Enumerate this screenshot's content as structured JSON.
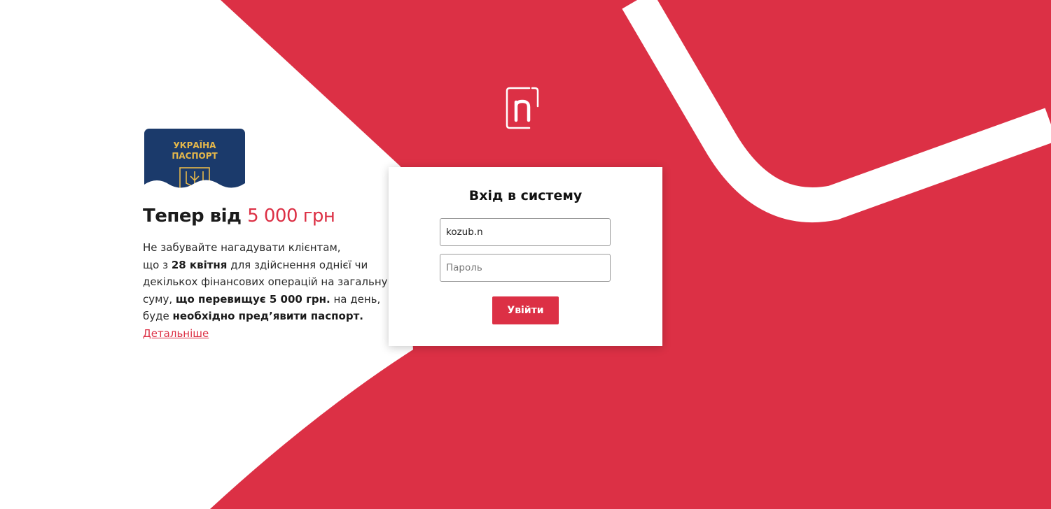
{
  "colors": {
    "brand_red": "#dc3045",
    "passport_blue": "#1b3a6b",
    "passport_gold": "#e6b84a"
  },
  "logo": {
    "icon": "n-logo-icon"
  },
  "promo": {
    "passport_icon": "passport-icon",
    "passport_line1": "УКРАЇНА",
    "passport_line2": "ПАСПОРТ",
    "title_prefix": "Тепер від",
    "title_amount": "5 000 грн",
    "text": {
      "l1": "Не забувайте нагадувати клієнтам,",
      "l2_a": "що з ",
      "l2_b": "28 квітня",
      "l2_c": " для здійснення однієї чи",
      "l3": "декількох фінансових операцій на загальну",
      "l4_a": "суму, ",
      "l4_b": "що перевищує 5 000 грн.",
      "l4_c": " на день,",
      "l5_a": "буде ",
      "l5_b": "необхідно пред’явити паспорт."
    },
    "link": "Детальніше"
  },
  "login": {
    "title": "Вхід в систему",
    "username_value": "kozub.n",
    "password_placeholder": "Пароль",
    "submit": "Увійти"
  }
}
